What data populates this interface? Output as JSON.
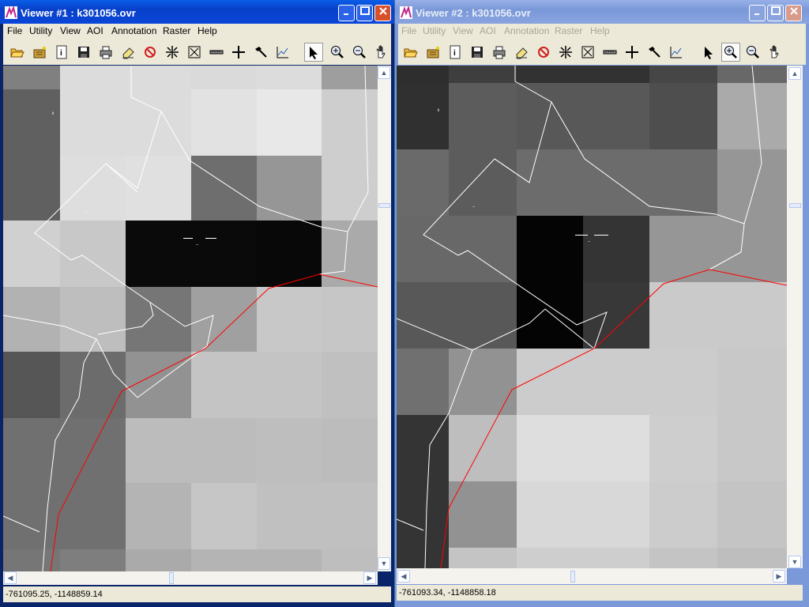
{
  "viewer1": {
    "title": "Viewer #1 : k301056.ovr",
    "menu": {
      "file": "File",
      "utility": "Utility",
      "view": "View",
      "aoi": "AOI",
      "annotation": "Annotation",
      "raster": "Raster",
      "help": "Help"
    },
    "status": "-761095.25, -1148859.14"
  },
  "viewer2": {
    "title": "Viewer #2 : k301056.ovr",
    "menu": {
      "file": "File",
      "utility": "Utility",
      "view": "View",
      "aoi": "AOI",
      "annotation": "Annotation",
      "raster": "Raster",
      "help": "Help"
    },
    "status": "-761093.34, -1148858.18"
  },
  "colors": {
    "active_title": "#0a46d8",
    "inactive_title": "#8aa4e0",
    "boundary": "#ff0000",
    "parcel": "#ffffff",
    "chrome": "#ece9d8"
  },
  "toolbar_icons": [
    "open-icon",
    "new-layer-icon",
    "info-icon",
    "save-icon",
    "print-icon",
    "eraser-icon",
    "clear-icon",
    "roam-icon",
    "fit-icon",
    "measure-icon",
    "crosshair-icon",
    "hammer-icon",
    "profile-icon",
    "select-arrow-icon",
    "zoom-in-icon",
    "zoom-out-icon",
    "pan-icon"
  ],
  "viewer1_selected_tool": "select-arrow-icon",
  "viewer2_selected_tool": "zoom-in-icon"
}
